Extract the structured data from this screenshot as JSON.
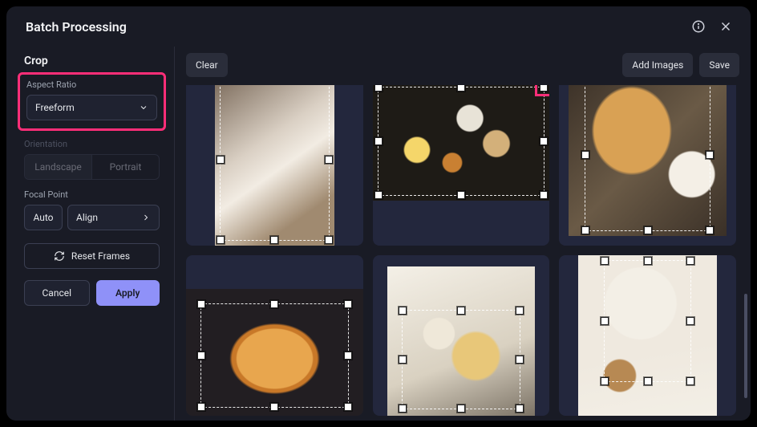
{
  "header": {
    "title": "Batch Processing"
  },
  "sidebar": {
    "title": "Crop",
    "aspect": {
      "label": "Aspect Ratio",
      "value": "Freeform"
    },
    "orientation": {
      "label": "Orientation",
      "landscape": "Landscape",
      "portrait": "Portrait"
    },
    "focal": {
      "label": "Focal Point",
      "auto": "Auto",
      "align": "Align"
    },
    "reset": "Reset Frames",
    "cancel": "Cancel",
    "apply": "Apply"
  },
  "toolbar": {
    "clear": "Clear",
    "add": "Add Images",
    "save": "Save"
  },
  "colors": {
    "highlight": "#ff2e78",
    "accent": "#8f91f8"
  }
}
